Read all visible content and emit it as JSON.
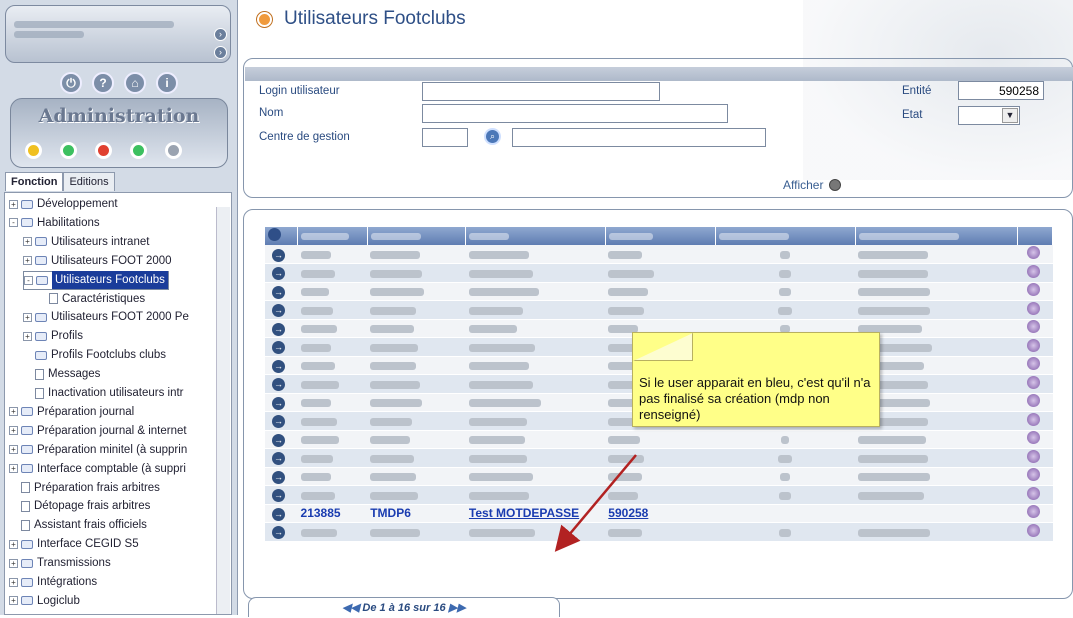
{
  "page": {
    "title": "Utilisateurs Footclubs"
  },
  "sidebar": {
    "brand": "Administration",
    "tabs": [
      "Fonction",
      "Editions"
    ],
    "tree": [
      {
        "label": "Développement",
        "depth": 0,
        "kind": "folder",
        "exp": "+"
      },
      {
        "label": "Habilitations",
        "depth": 0,
        "kind": "folder",
        "exp": "-"
      },
      {
        "label": "Utilisateurs intranet",
        "depth": 1,
        "kind": "folder",
        "exp": "+"
      },
      {
        "label": "Utilisateurs FOOT 2000",
        "depth": 1,
        "kind": "folder",
        "exp": "+"
      },
      {
        "label": "Utilisateurs Footclubs",
        "depth": 1,
        "kind": "folder",
        "exp": "-",
        "selected": true
      },
      {
        "label": "Caractéristiques",
        "depth": 2,
        "kind": "page",
        "exp": ""
      },
      {
        "label": "Utilisateurs FOOT 2000 Pe",
        "depth": 1,
        "kind": "folder",
        "exp": "+"
      },
      {
        "label": "Profils",
        "depth": 1,
        "kind": "folder",
        "exp": "+"
      },
      {
        "label": "Profils Footclubs clubs",
        "depth": 1,
        "kind": "folder",
        "exp": ""
      },
      {
        "label": "Messages",
        "depth": 1,
        "kind": "page",
        "exp": ""
      },
      {
        "label": "Inactivation utilisateurs intr",
        "depth": 1,
        "kind": "page",
        "exp": ""
      },
      {
        "label": "Préparation journal",
        "depth": 0,
        "kind": "folder",
        "exp": "+"
      },
      {
        "label": "Préparation journal & internet",
        "depth": 0,
        "kind": "folder",
        "exp": "+"
      },
      {
        "label": "Préparation minitel (à supprin",
        "depth": 0,
        "kind": "folder",
        "exp": "+"
      },
      {
        "label": "Interface comptable (à suppri",
        "depth": 0,
        "kind": "folder",
        "exp": "+"
      },
      {
        "label": "Préparation frais arbitres",
        "depth": 0,
        "kind": "page",
        "exp": ""
      },
      {
        "label": "Détopage frais arbitres",
        "depth": 0,
        "kind": "page",
        "exp": ""
      },
      {
        "label": "Assistant frais officiels",
        "depth": 0,
        "kind": "page",
        "exp": ""
      },
      {
        "label": "Interface CEGID S5",
        "depth": 0,
        "kind": "folder",
        "exp": "+"
      },
      {
        "label": "Transmissions",
        "depth": 0,
        "kind": "folder",
        "exp": "+"
      },
      {
        "label": "Intégrations",
        "depth": 0,
        "kind": "folder",
        "exp": "+"
      },
      {
        "label": "Logiclub",
        "depth": 0,
        "kind": "folder",
        "exp": "+"
      }
    ]
  },
  "form": {
    "login_label": "Login utilisateur",
    "login_value": "",
    "nom_label": "Nom",
    "nom_value": "",
    "centre_label": "Centre de gestion",
    "centre_code": "",
    "centre_name": "",
    "entite_label": "Entité",
    "entite_value": "590258",
    "etat_label": "Etat",
    "etat_value": "",
    "afficher": "Afficher"
  },
  "table": {
    "highlight_row": {
      "id": "213885",
      "login": "TMDP6",
      "nom": "Test MOTDEPASSE",
      "entite": "590258"
    },
    "row_count": 16,
    "highlight_index": 14
  },
  "note": {
    "text": "Si le user apparait en bleu, c'est qu'il n'a pas finalisé sa création (mdp non renseigné)"
  },
  "pager": {
    "text": "De 1 à 16 sur 16"
  },
  "colors": {
    "accent": "#2e4f86",
    "header": "#5f7db2",
    "highlight": "#1a3cb0",
    "note": "#ffff88",
    "arrow": "#b22222"
  }
}
